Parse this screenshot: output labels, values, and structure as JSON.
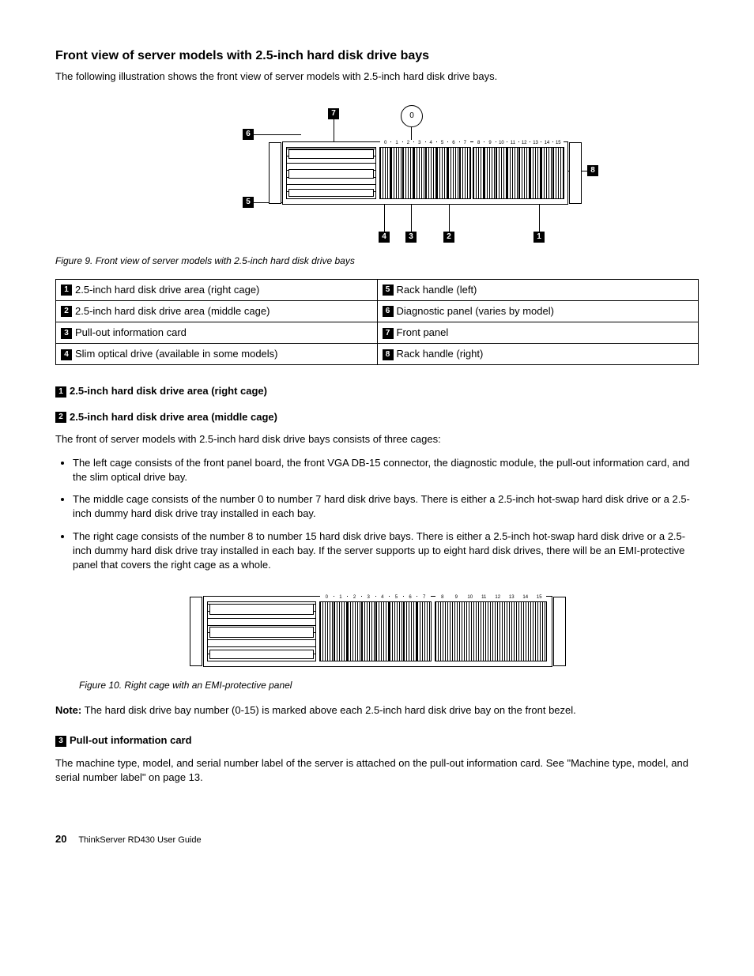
{
  "section": {
    "title": "Front view of server models with 2.5-inch hard disk drive bays",
    "intro": "The following illustration shows the front view of server models with 2.5-inch hard disk drive bays."
  },
  "figure9": {
    "caption": "Figure 9.  Front view of server models with 2.5-inch hard disk drive bays",
    "circle_label": "0",
    "callouts": {
      "c1": "1",
      "c2": "2",
      "c3": "3",
      "c4": "4",
      "c5": "5",
      "c6": "6",
      "c7": "7",
      "c8": "8"
    },
    "bay_labels_mid": [
      "0",
      "1",
      "2",
      "3",
      "4",
      "5",
      "6",
      "7"
    ],
    "bay_labels_right": [
      "8",
      "9",
      "10",
      "11",
      "12",
      "13",
      "14",
      "15"
    ]
  },
  "callout_table": {
    "r1a_num": "1",
    "r1a": "2.5-inch hard disk drive area (right cage)",
    "r1b_num": "5",
    "r1b": "Rack handle (left)",
    "r2a_num": "2",
    "r2a": "2.5-inch hard disk drive area (middle cage)",
    "r2b_num": "6",
    "r2b": "Diagnostic panel (varies by model)",
    "r3a_num": "3",
    "r3a": "Pull-out information card",
    "r3b_num": "7",
    "r3b": "Front panel",
    "r4a_num": "4",
    "r4a": "Slim optical drive (available in some models)",
    "r4b_num": "8",
    "r4b": "Rack handle (right)"
  },
  "headings": {
    "h1_num": "1",
    "h1": "2.5-inch hard disk drive area (right cage)",
    "h2_num": "2",
    "h2": "2.5-inch hard disk drive area (middle cage)",
    "h3_num": "3",
    "h3": "Pull-out information card"
  },
  "body": {
    "cages_intro": "The front of server models with 2.5-inch hard disk drive bays consists of three cages:",
    "bullet1": "The left cage consists of the front panel board, the front VGA DB-15 connector, the diagnostic module, the pull-out information card, and the slim optical drive bay.",
    "bullet2": "The middle cage consists of the number 0 to number 7 hard disk drive bays. There is either a 2.5-inch hot-swap hard disk drive or a 2.5-inch dummy hard disk drive tray installed in each bay.",
    "bullet3": "The right cage consists of the number 8 to number 15 hard disk drive bays. There is either a 2.5-inch hot-swap hard disk drive or a 2.5-inch dummy hard disk drive tray installed in each bay. If the server supports up to eight hard disk drives, there will be an EMI-protective panel that covers the right cage as a whole.",
    "note_label": "Note:",
    "note_text": " The hard disk drive bay number (0-15) is marked above each 2.5-inch hard disk drive bay on the front bezel.",
    "pullout_text": "The machine type, model, and serial number label of the server is attached on the pull-out information card. See \"Machine type, model, and serial number label\" on page 13."
  },
  "figure10": {
    "caption": "Figure 10.  Right cage with an EMI-protective panel",
    "bay_labels_mid": [
      "0",
      "1",
      "2",
      "3",
      "4",
      "5",
      "6",
      "7"
    ],
    "bay_labels_right": [
      "8",
      "9",
      "10",
      "11",
      "12",
      "13",
      "14",
      "15"
    ]
  },
  "footer": {
    "page": "20",
    "doc": "ThinkServer RD430 User Guide"
  }
}
